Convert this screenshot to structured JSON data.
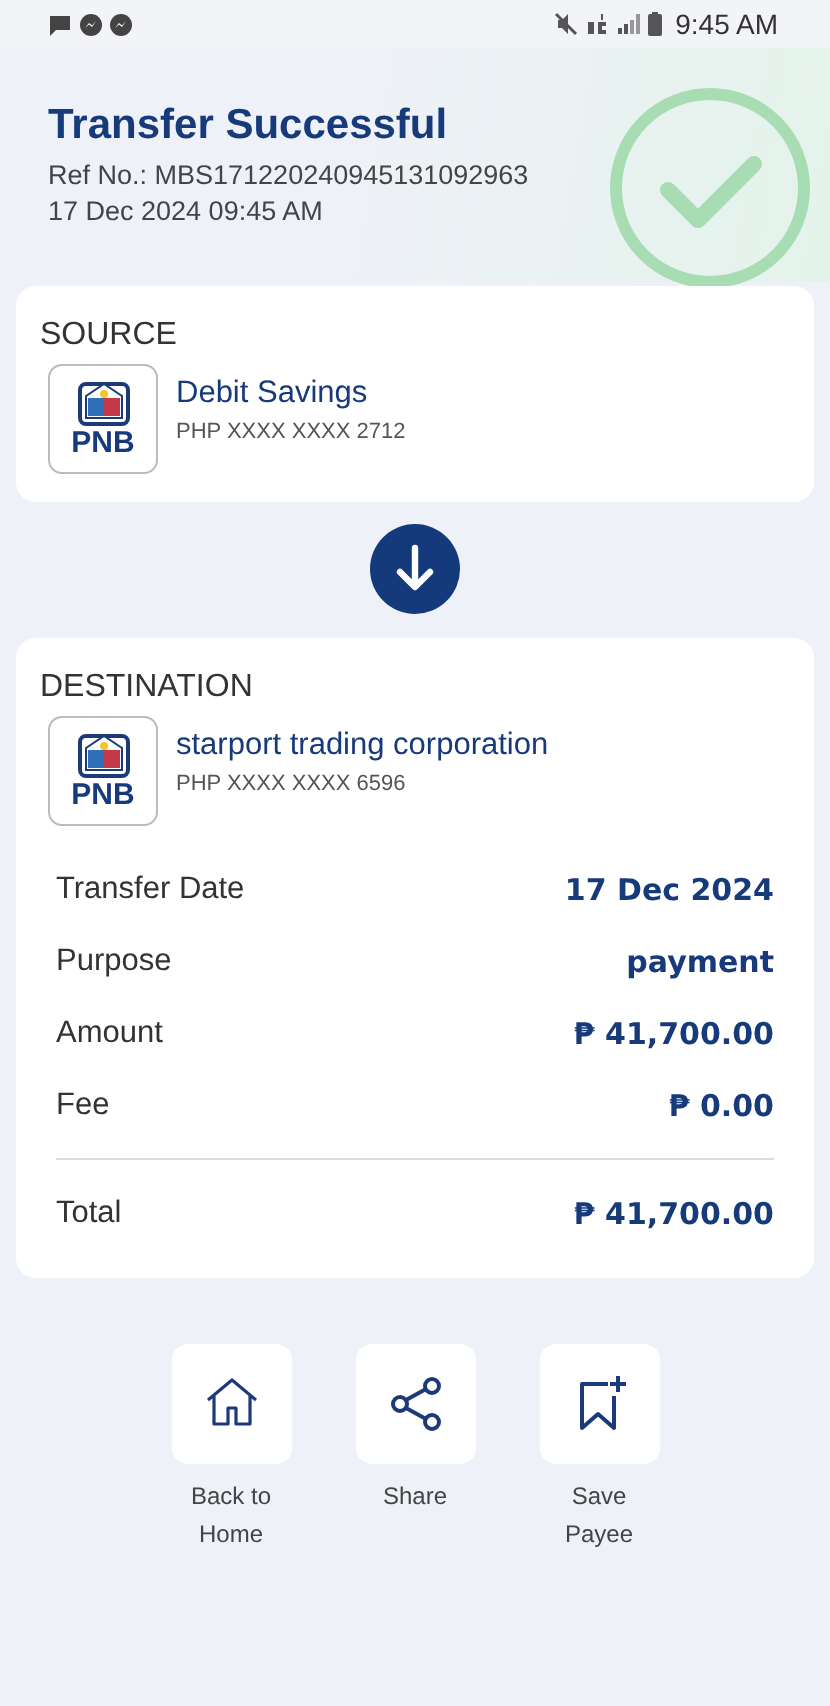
{
  "status_bar": {
    "time": "9:45 AM"
  },
  "header": {
    "title": "Transfer Successful",
    "reference": "Ref No.: MBS171220240945131092963",
    "datetime": "17 Dec 2024 09:45 AM"
  },
  "source": {
    "heading": "SOURCE",
    "bank": "PNB",
    "account_name": "Debit Savings",
    "account_number": "PHP XXXX XXXX 2712"
  },
  "destination": {
    "heading": "DESTINATION",
    "bank": "PNB",
    "account_name": "starport trading corporation",
    "account_number": "PHP XXXX XXXX 6596"
  },
  "details": [
    {
      "label": "Transfer Date",
      "value": "17 Dec 2024"
    },
    {
      "label": "Purpose",
      "value": "payment"
    },
    {
      "label": "Amount",
      "value": "₱ 41,700.00"
    },
    {
      "label": "Fee",
      "value": "₱ 0.00"
    }
  ],
  "total": {
    "label": "Total",
    "value": "₱ 41,700.00"
  },
  "actions": [
    {
      "kind": "home",
      "label": "Back to Home"
    },
    {
      "kind": "share",
      "label": "Share"
    },
    {
      "kind": "bookmark",
      "label": "Save Payee"
    }
  ]
}
